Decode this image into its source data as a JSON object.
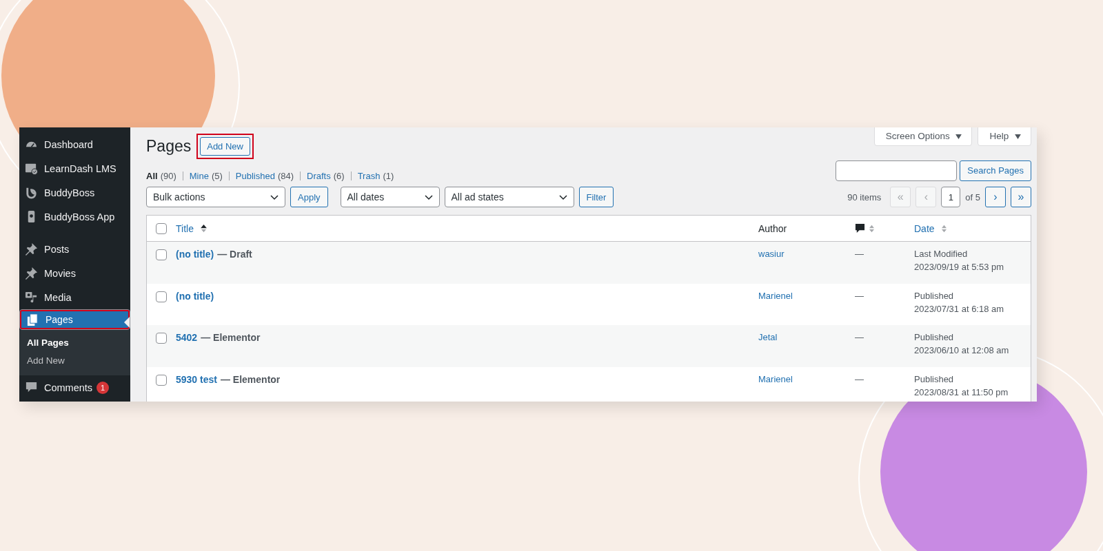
{
  "sidebar": {
    "groups": [
      [
        {
          "label": "Dashboard",
          "selected": false,
          "highlighted": false
        },
        {
          "label": "LearnDash LMS",
          "selected": false,
          "highlighted": false
        },
        {
          "label": "BuddyBoss",
          "selected": false,
          "highlighted": false
        },
        {
          "label": "BuddyBoss App",
          "selected": false,
          "highlighted": false
        }
      ],
      [
        {
          "label": "Posts",
          "selected": false,
          "highlighted": false
        },
        {
          "label": "Movies",
          "selected": false,
          "highlighted": false
        },
        {
          "label": "Media",
          "selected": false,
          "highlighted": false
        },
        {
          "label": "Pages",
          "selected": true,
          "highlighted": true,
          "submenu": [
            {
              "label": "All Pages",
              "selected": true
            },
            {
              "label": "Add New",
              "selected": false
            }
          ]
        },
        {
          "label": "Comments",
          "selected": false,
          "highlighted": false,
          "badge": "1"
        }
      ]
    ]
  },
  "header": {
    "title": "Pages",
    "add_new": {
      "label": "Add New",
      "highlighted": true
    },
    "screen_options": "Screen Options",
    "help": "Help"
  },
  "views": [
    {
      "label": "All",
      "count": "(90)",
      "selected": true
    },
    {
      "label": "Mine",
      "count": "(5)",
      "selected": false
    },
    {
      "label": "Published",
      "count": "(84)",
      "selected": false
    },
    {
      "label": "Drafts",
      "count": "(6)",
      "selected": false
    },
    {
      "label": "Trash",
      "count": "(1)",
      "selected": false
    }
  ],
  "search": {
    "button": "Search Pages"
  },
  "filters": {
    "bulk": "Bulk actions",
    "apply": "Apply",
    "dates": "All dates",
    "ad_states": "All ad states",
    "filter": "Filter"
  },
  "pagination": {
    "count": "90 items",
    "page": "1",
    "of": "of 5",
    "buttons": [
      {
        "label": "«",
        "disabled": true
      },
      {
        "label": "‹",
        "disabled": true
      },
      {
        "label": "›",
        "disabled": false
      },
      {
        "label": "»",
        "disabled": false
      }
    ]
  },
  "table": {
    "select_all_checked": false,
    "columns": [
      {
        "label": "Title",
        "kind": "sorted"
      },
      {
        "label": "Author",
        "kind": "plain"
      },
      {
        "kind": "comments"
      },
      {
        "label": "Date",
        "kind": "sortable"
      }
    ],
    "rows": [
      {
        "title": "(no title)",
        "state": "— Draft",
        "author": "wasiur",
        "comments": "—",
        "status": "Last Modified",
        "date": "2023/09/19 at 5:53 pm",
        "checked": false
      },
      {
        "title": "(no title)",
        "author": "Marienel",
        "comments": "—",
        "status": "Published",
        "date": "2023/07/31 at 6:18 am",
        "checked": false
      },
      {
        "title": "5402",
        "state": "— Elementor",
        "author": "Jetal",
        "comments": "—",
        "status": "Published",
        "date": "2023/06/10 at 12:08 am",
        "checked": false
      },
      {
        "title": "5930 test",
        "state": "— Elementor",
        "author": "Marienel",
        "comments": "—",
        "status": "Published",
        "date": "2023/08/31 at 11:50 pm",
        "checked": false
      }
    ]
  }
}
